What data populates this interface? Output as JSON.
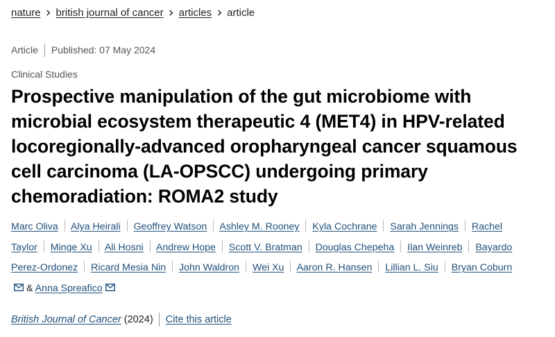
{
  "breadcrumb": {
    "items": [
      "nature",
      "british journal of cancer",
      "articles"
    ],
    "current": "article"
  },
  "meta": {
    "type": "Article",
    "published": "Published: 07 May 2024"
  },
  "section": "Clinical Studies",
  "title": "Prospective manipulation of the gut microbiome with microbial ecosystem therapeutic 4 (MET4) in HPV-related locoregionally-advanced oropharyngeal cancer squamous cell carcinoma (LA-OPSCC) undergoing primary chemoradiation: ROMA2 study",
  "authors": {
    "list": [
      "Marc Oliva",
      "Alya Heirali",
      "Geoffrey Watson",
      "Ashley M. Rooney",
      "Kyla Cochrane",
      "Sarah Jennings",
      "Rachel Taylor",
      "Minge Xu",
      "Ali Hosni",
      "Andrew Hope",
      "Scott V. Bratman",
      "Douglas Chepeha",
      "Ilan Weinreb",
      "Bayardo Perez-Ordonez",
      "Ricard Mesia Nin",
      "John Waldron",
      "Wei Xu",
      "Aaron R. Hansen",
      "Lillian L. Siu",
      "Bryan Coburn"
    ],
    "and_text": "&",
    "last": "Anna Spreafico",
    "mail_icon": "envelope-icon"
  },
  "citation": {
    "journal": "British Journal of Cancer",
    "year": "(2024)",
    "cite_label": "Cite this article"
  }
}
